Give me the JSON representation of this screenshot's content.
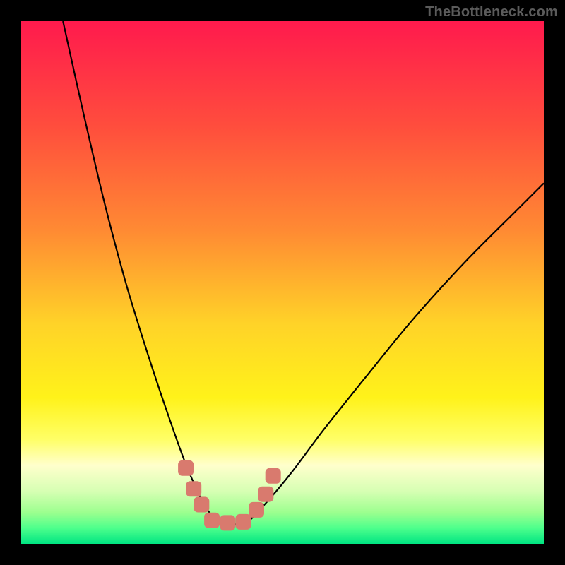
{
  "watermark": {
    "text": "TheBottleneck.com"
  },
  "chart_data": {
    "type": "line",
    "title": "",
    "xlabel": "",
    "ylabel": "",
    "xlim": [
      0,
      100
    ],
    "ylim": [
      0,
      100
    ],
    "grid": false,
    "legend": false,
    "background_gradient": {
      "direction": "vertical",
      "stops": [
        {
          "offset": 0.0,
          "color": "#ff1a4d"
        },
        {
          "offset": 0.2,
          "color": "#ff4d3d"
        },
        {
          "offset": 0.4,
          "color": "#ff8a33"
        },
        {
          "offset": 0.58,
          "color": "#ffd328"
        },
        {
          "offset": 0.72,
          "color": "#fff21a"
        },
        {
          "offset": 0.8,
          "color": "#ffff66"
        },
        {
          "offset": 0.85,
          "color": "#ffffcc"
        },
        {
          "offset": 0.9,
          "color": "#d6ffb3"
        },
        {
          "offset": 0.94,
          "color": "#9cff8f"
        },
        {
          "offset": 0.97,
          "color": "#4dff8c"
        },
        {
          "offset": 1.0,
          "color": "#00e582"
        }
      ]
    },
    "series": [
      {
        "name": "curve",
        "comment": "V-shaped black curve; yNorm=0 at top of plot, yNorm=1 at bottom. Trough near xNorm≈0.36–0.43 reaching yNorm≈0.96.",
        "x": [
          0.08,
          0.12,
          0.16,
          0.2,
          0.24,
          0.28,
          0.32,
          0.36,
          0.4,
          0.43,
          0.47,
          0.52,
          0.58,
          0.66,
          0.75,
          0.85,
          0.95,
          1.0
        ],
        "yNorm": [
          0.0,
          0.18,
          0.35,
          0.5,
          0.63,
          0.75,
          0.86,
          0.94,
          0.96,
          0.96,
          0.92,
          0.86,
          0.78,
          0.68,
          0.57,
          0.46,
          0.36,
          0.31
        ]
      },
      {
        "name": "trough-markers",
        "comment": "Salmon rounded squares clustered around the curve minimum (approximate positions in normalized coords).",
        "points": [
          {
            "xNorm": 0.315,
            "yNorm": 0.855
          },
          {
            "xNorm": 0.33,
            "yNorm": 0.895
          },
          {
            "xNorm": 0.345,
            "yNorm": 0.925
          },
          {
            "xNorm": 0.365,
            "yNorm": 0.955
          },
          {
            "xNorm": 0.395,
            "yNorm": 0.96
          },
          {
            "xNorm": 0.425,
            "yNorm": 0.958
          },
          {
            "xNorm": 0.45,
            "yNorm": 0.935
          },
          {
            "xNorm": 0.468,
            "yNorm": 0.905
          },
          {
            "xNorm": 0.482,
            "yNorm": 0.87
          }
        ],
        "style": {
          "size": 22,
          "rx": 6,
          "fill": "#d97a6e"
        }
      }
    ]
  }
}
